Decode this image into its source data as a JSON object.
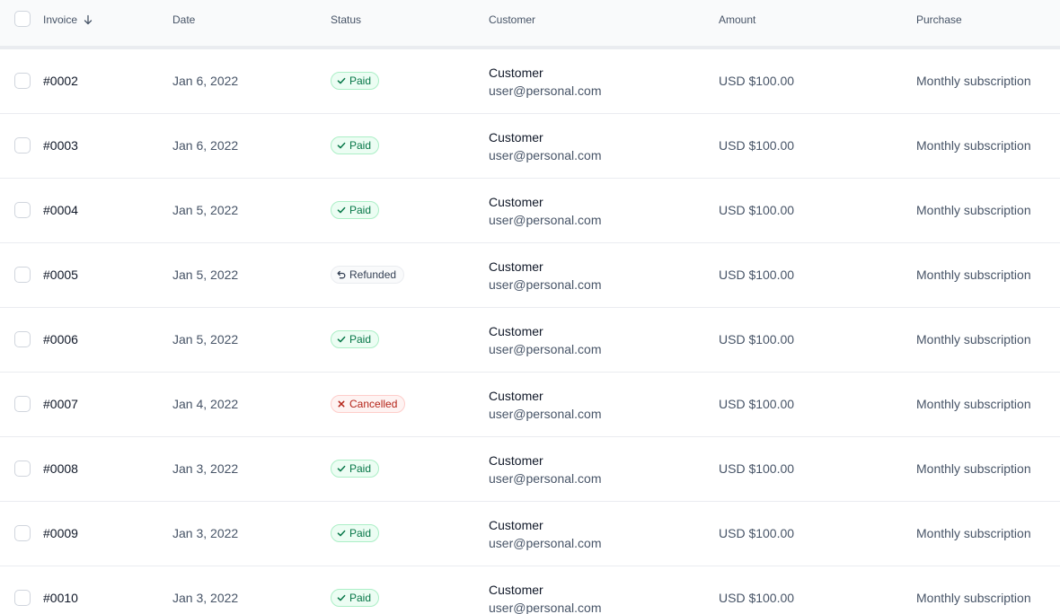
{
  "columns": {
    "invoice": "Invoice",
    "date": "Date",
    "status": "Status",
    "customer": "Customer",
    "amount": "Amount",
    "purchase": "Purchase"
  },
  "sort_icon": "arrow-down-icon",
  "status_colors": {
    "paid": "#067647",
    "refunded": "#344054",
    "cancelled": "#b42318"
  },
  "rows": [
    {
      "invoice": "#0002",
      "date": "Jan 6, 2022",
      "status": "Paid",
      "status_type": "paid",
      "customer_name": "Customer",
      "customer_email": "user@personal.com",
      "amount": "USD $100.00",
      "purchase": "Monthly subscription"
    },
    {
      "invoice": "#0003",
      "date": "Jan 6, 2022",
      "status": "Paid",
      "status_type": "paid",
      "customer_name": "Customer",
      "customer_email": "user@personal.com",
      "amount": "USD $100.00",
      "purchase": "Monthly subscription"
    },
    {
      "invoice": "#0004",
      "date": "Jan 5, 2022",
      "status": "Paid",
      "status_type": "paid",
      "customer_name": "Customer",
      "customer_email": "user@personal.com",
      "amount": "USD $100.00",
      "purchase": "Monthly subscription"
    },
    {
      "invoice": "#0005",
      "date": "Jan 5, 2022",
      "status": "Refunded",
      "status_type": "refunded",
      "customer_name": "Customer",
      "customer_email": "user@personal.com",
      "amount": "USD $100.00",
      "purchase": "Monthly subscription"
    },
    {
      "invoice": "#0006",
      "date": "Jan 5, 2022",
      "status": "Paid",
      "status_type": "paid",
      "customer_name": "Customer",
      "customer_email": "user@personal.com",
      "amount": "USD $100.00",
      "purchase": "Monthly subscription"
    },
    {
      "invoice": "#0007",
      "date": "Jan 4, 2022",
      "status": "Cancelled",
      "status_type": "cancelled",
      "customer_name": "Customer",
      "customer_email": "user@personal.com",
      "amount": "USD $100.00",
      "purchase": "Monthly subscription"
    },
    {
      "invoice": "#0008",
      "date": "Jan 3, 2022",
      "status": "Paid",
      "status_type": "paid",
      "customer_name": "Customer",
      "customer_email": "user@personal.com",
      "amount": "USD $100.00",
      "purchase": "Monthly subscription"
    },
    {
      "invoice": "#0009",
      "date": "Jan 3, 2022",
      "status": "Paid",
      "status_type": "paid",
      "customer_name": "Customer",
      "customer_email": "user@personal.com",
      "amount": "USD $100.00",
      "purchase": "Monthly subscription"
    },
    {
      "invoice": "#0010",
      "date": "Jan 3, 2022",
      "status": "Paid",
      "status_type": "paid",
      "customer_name": "Customer",
      "customer_email": "user@personal.com",
      "amount": "USD $100.00",
      "purchase": "Monthly subscription"
    }
  ]
}
